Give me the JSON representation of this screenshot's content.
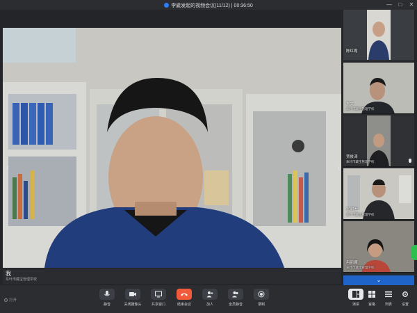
{
  "window": {
    "title": "李崴发起的视频会议(11/12) | 00:36:50",
    "minimize": "—",
    "maximize": "□",
    "close": "✕"
  },
  "main_speaker": {
    "name": "我",
    "org": "阜叶市藏宝管理学校"
  },
  "participants": [
    {
      "name": "陈红霞",
      "org": ""
    },
    {
      "name": "东文",
      "org": "阜叶市藏宝管理学校"
    },
    {
      "name": "贾俊涛",
      "org": "阜叶市藏宝管理学校"
    },
    {
      "name": "张明杰",
      "org": "阜叶市藏宝管理学校"
    },
    {
      "name": "冉丽娜",
      "org": "阜叶市藏宝管理学校"
    }
  ],
  "status_text": "打开",
  "toolbar": {
    "mute": "静音",
    "camera_off": "关闭摄像头",
    "share_screen": "共享窗口",
    "end_meeting": "结束会议",
    "invite": "加人",
    "mute_all": "全员静音",
    "record": "录制",
    "view_speaker": "演讲",
    "view_grid": "宫格",
    "view_list": "列表",
    "settings": "设置"
  },
  "icons": [
    "shield-icon",
    "mic-icon",
    "camera-icon",
    "share-icon",
    "phone-hangup-icon",
    "add-person-icon",
    "mute-all-icon",
    "record-icon",
    "speaker-view-icon",
    "grid-view-icon",
    "list-view-icon",
    "settings-icon",
    "chevron-down-icon",
    "chevron-left-icon",
    "chevron-right-icon"
  ],
  "colors": {
    "end_button": "#f25a3c",
    "accent": "#1f64c9",
    "fab": "#2fbf4f"
  }
}
